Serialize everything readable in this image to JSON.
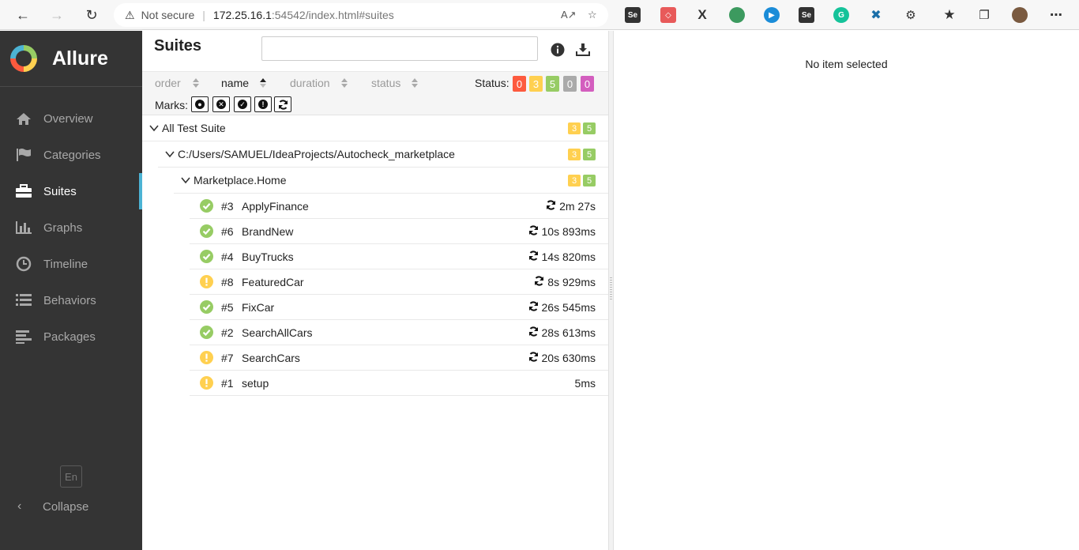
{
  "browser": {
    "security_label": "Not secure",
    "url_host": "172.25.16.1",
    "url_rest": ":54542/index.html#suites"
  },
  "sidebar": {
    "brand": "Allure",
    "items": [
      {
        "label": "Overview",
        "icon": "home-icon"
      },
      {
        "label": "Categories",
        "icon": "flag-icon"
      },
      {
        "label": "Suites",
        "icon": "briefcase-icon",
        "active": true
      },
      {
        "label": "Graphs",
        "icon": "bar-chart-icon"
      },
      {
        "label": "Timeline",
        "icon": "clock-icon"
      },
      {
        "label": "Behaviors",
        "icon": "list-icon"
      },
      {
        "label": "Packages",
        "icon": "align-left-icon"
      }
    ],
    "language": "En",
    "collapse_label": "Collapse"
  },
  "pane": {
    "title": "Suites",
    "sort": {
      "order": "order",
      "name": "name",
      "duration": "duration",
      "status": "status"
    },
    "status_label": "Status:",
    "status_counts": {
      "failed": "0",
      "broken": "3",
      "passed": "5",
      "skipped": "0",
      "unknown": "0"
    },
    "marks_label": "Marks:",
    "colors": {
      "failed": "#fd5a3e",
      "broken": "#ffd050",
      "passed": "#97cc64",
      "skipped": "#aaaaaa",
      "unknown": "#d35ebe",
      "accent": "#4cb3d4"
    },
    "tree": {
      "root": {
        "label": "All Test Suite",
        "broken": "3",
        "passed": "5"
      },
      "path": {
        "label": "C:/Users/SAMUEL/IdeaProjects/Autocheck_marketplace",
        "broken": "3",
        "passed": "5"
      },
      "suite": {
        "label": "Marketplace.Home",
        "broken": "3",
        "passed": "5"
      },
      "tests": [
        {
          "num": "#3",
          "name": "ApplyFinance",
          "duration": "2m 27s",
          "status": "passed",
          "retry": true
        },
        {
          "num": "#6",
          "name": "BrandNew",
          "duration": "10s 893ms",
          "status": "passed",
          "retry": true
        },
        {
          "num": "#4",
          "name": "BuyTrucks",
          "duration": "14s 820ms",
          "status": "passed",
          "retry": true
        },
        {
          "num": "#8",
          "name": "FeaturedCar",
          "duration": "8s 929ms",
          "status": "broken",
          "retry": true
        },
        {
          "num": "#5",
          "name": "FixCar",
          "duration": "26s 545ms",
          "status": "passed",
          "retry": true
        },
        {
          "num": "#2",
          "name": "SearchAllCars",
          "duration": "28s 613ms",
          "status": "passed",
          "retry": true
        },
        {
          "num": "#7",
          "name": "SearchCars",
          "duration": "20s 630ms",
          "status": "broken",
          "retry": true
        },
        {
          "num": "#1",
          "name": "setup",
          "duration": "5ms",
          "status": "broken",
          "retry": false
        }
      ]
    }
  },
  "detail": {
    "empty_text": "No item selected"
  }
}
